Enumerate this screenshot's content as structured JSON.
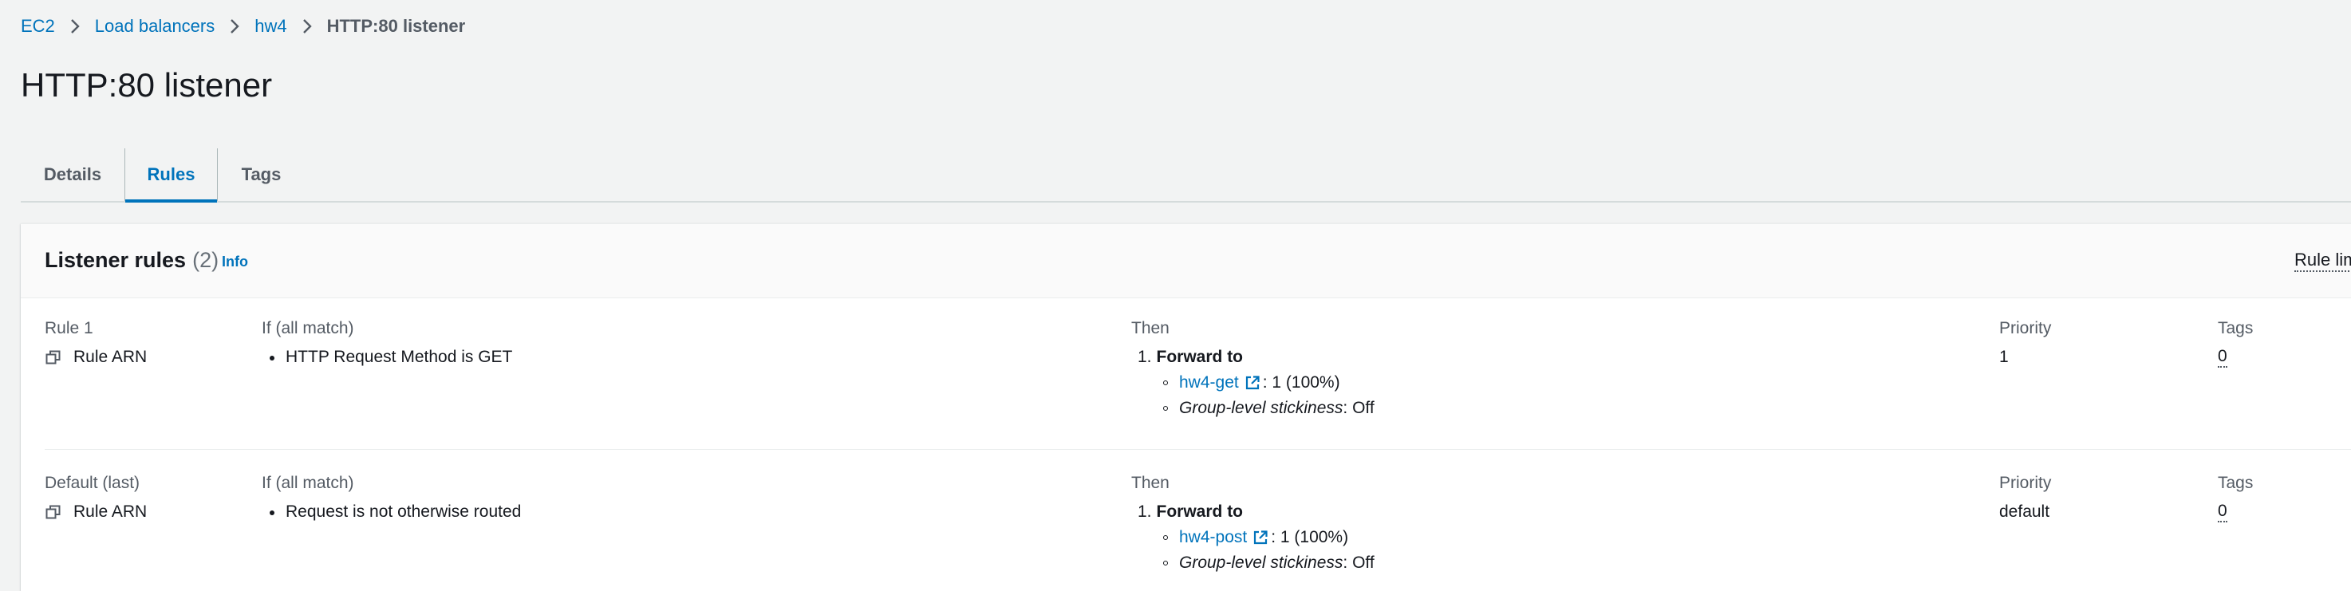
{
  "breadcrumb": {
    "items": [
      "EC2",
      "Load balancers",
      "hw4"
    ],
    "current": "HTTP:80 listener"
  },
  "page": {
    "title": "HTTP:80 listener"
  },
  "tabs": [
    {
      "label": "Details",
      "active": false
    },
    {
      "label": "Rules",
      "active": true
    },
    {
      "label": "Tags",
      "active": false
    }
  ],
  "listener_rules": {
    "title": "Listener rules",
    "count": "(2)",
    "info": "Info",
    "rule_limits": "Rule limits"
  },
  "rules": [
    {
      "name": "Rule 1",
      "arn_label": "Rule ARN",
      "if_label": "If (all match)",
      "condition": "HTTP Request Method is GET",
      "then_label": "Then",
      "action_num": "1.",
      "action": "Forward to",
      "target_group": "hw4-get",
      "target_weight": ": 1 (100%)",
      "stickiness_label": "Group-level stickiness",
      "stickiness_value": ": Off",
      "priority_label": "Priority",
      "priority": "1",
      "tags_label": "Tags",
      "tags": "0"
    },
    {
      "name": "Default (last)",
      "arn_label": "Rule ARN",
      "if_label": "If (all match)",
      "condition": "Request is not otherwise routed",
      "then_label": "Then",
      "action_num": "1.",
      "action": "Forward to",
      "target_group": "hw4-post",
      "target_weight": ": 1 (100%)",
      "stickiness_label": "Group-level stickiness",
      "stickiness_value": ": Off",
      "priority_label": "Priority",
      "priority": "default",
      "tags_label": "Tags",
      "tags": "0"
    }
  ],
  "colors": {
    "link": "#0073bb",
    "text": "#16191f",
    "secondary_text": "#545b64",
    "background": "#f2f3f3",
    "panel_header": "#fafafa"
  },
  "icons": [
    "chevron-right-icon",
    "copy-icon",
    "external-link-icon"
  ]
}
